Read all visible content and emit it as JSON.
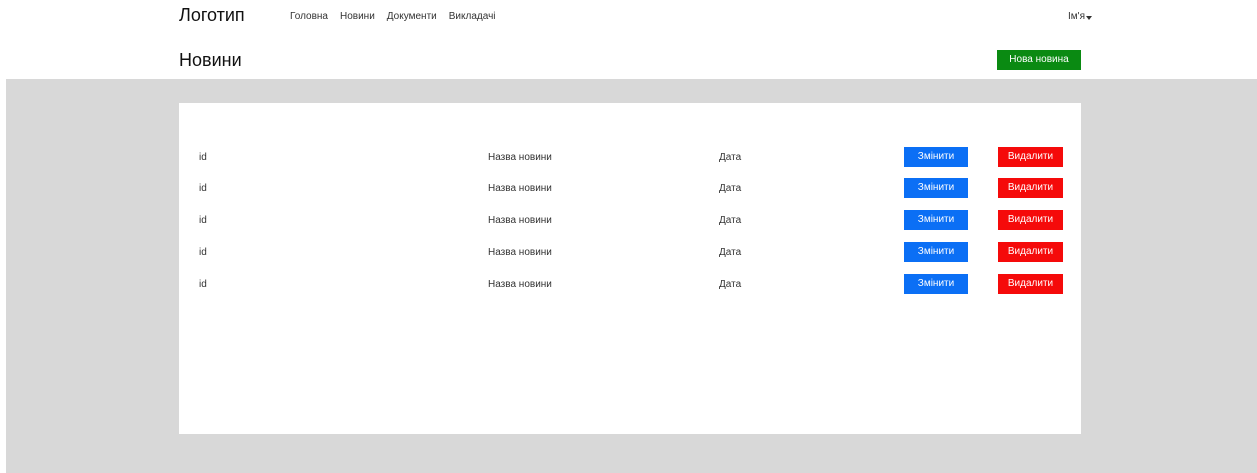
{
  "header": {
    "logo": "Логотип",
    "nav": [
      "Головна",
      "Новини",
      "Документи",
      "Викладачі"
    ],
    "user_name": "Ім'я"
  },
  "page": {
    "title": "Новини",
    "new_button": "Нова новина"
  },
  "table": {
    "rows": [
      {
        "id": "id",
        "title": "Назва новини",
        "date": "Дата",
        "edit": "Змінити",
        "delete": "Видалити"
      },
      {
        "id": "id",
        "title": "Назва новини",
        "date": "Дата",
        "edit": "Змінити",
        "delete": "Видалити"
      },
      {
        "id": "id",
        "title": "Назва новини",
        "date": "Дата",
        "edit": "Змінити",
        "delete": "Видалити"
      },
      {
        "id": "id",
        "title": "Назва новини",
        "date": "Дата",
        "edit": "Змінити",
        "delete": "Видалити"
      },
      {
        "id": "id",
        "title": "Назва новини",
        "date": "Дата",
        "edit": "Змінити",
        "delete": "Видалити"
      }
    ]
  },
  "colors": {
    "new_button": "#0a8a12",
    "edit_button": "#0b6ff5",
    "delete_button": "#f50a0a",
    "background": "#d8d8d8"
  }
}
